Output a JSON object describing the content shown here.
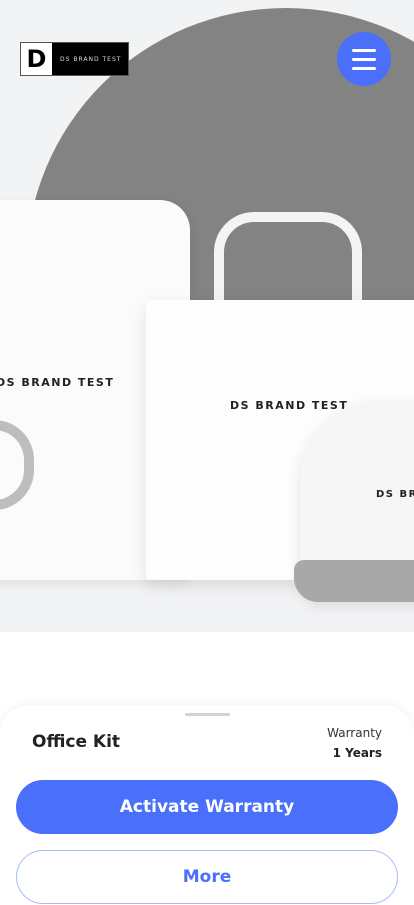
{
  "header": {
    "logo_mark": "D",
    "logo_text": "DS BRAND TEST",
    "menu_icon": "hamburger-icon",
    "accent": "#4a6ffb"
  },
  "hero": {
    "print_text": "DS BRAND TEST",
    "cap_text": "DS BR"
  },
  "product": {
    "name": "Office Kit",
    "warranty_label": "Warranty",
    "warranty_value": "1 Years"
  },
  "actions": {
    "activate_label": "Activate Warranty",
    "more_label": "More"
  }
}
